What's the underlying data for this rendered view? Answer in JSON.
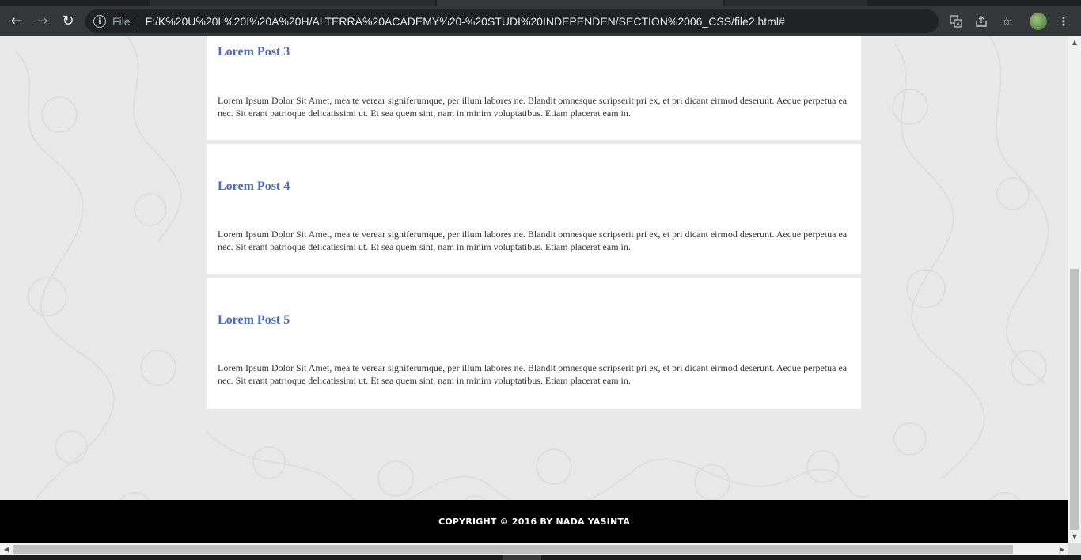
{
  "browser": {
    "scheme": "File",
    "url": "F:/K%20U%20L%20I%20A%20H/ALTERRA%20ACADEMY%20-%20STUDI%20INDEPENDEN/SECTION%2006_CSS/file2.html#"
  },
  "posts": [
    {
      "title": "Lorem Post 3",
      "body": "Lorem Ipsum Dolor Sit Amet, mea te verear signiferumque, per illum labores ne. Blandit omnesque scripserit pri ex, et pri dicant eirmod deserunt. Aeque perpetua ea nec. Sit erant patrioque delicatissimi ut. Et sea quem sint, nam in minim voluptatibus. Etiam placerat eam in."
    },
    {
      "title": "Lorem Post 4",
      "body": "Lorem Ipsum Dolor Sit Amet, mea te verear signiferumque, per illum labores ne. Blandit omnesque scripserit pri ex, et pri dicant eirmod deserunt. Aeque perpetua ea nec. Sit erant patrioque delicatissimi ut. Et sea quem sint, nam in minim voluptatibus. Etiam placerat eam in."
    },
    {
      "title": "Lorem Post 5",
      "body": "Lorem Ipsum Dolor Sit Amet, mea te verear signiferumque, per illum labores ne. Blandit omnesque scripserit pri ex, et pri dicant eirmod deserunt. Aeque perpetua ea nec. Sit erant patrioque delicatissimi ut. Et sea quem sint, nam in minim voluptatibus. Etiam placerat eam in."
    }
  ],
  "footer": {
    "copyright": "COPYRIGHT © 2016 BY NADA YASINTA"
  },
  "colors": {
    "post_title": "#4a6bc6",
    "page_background": "#e9e9e9",
    "footer_background": "#000000"
  }
}
